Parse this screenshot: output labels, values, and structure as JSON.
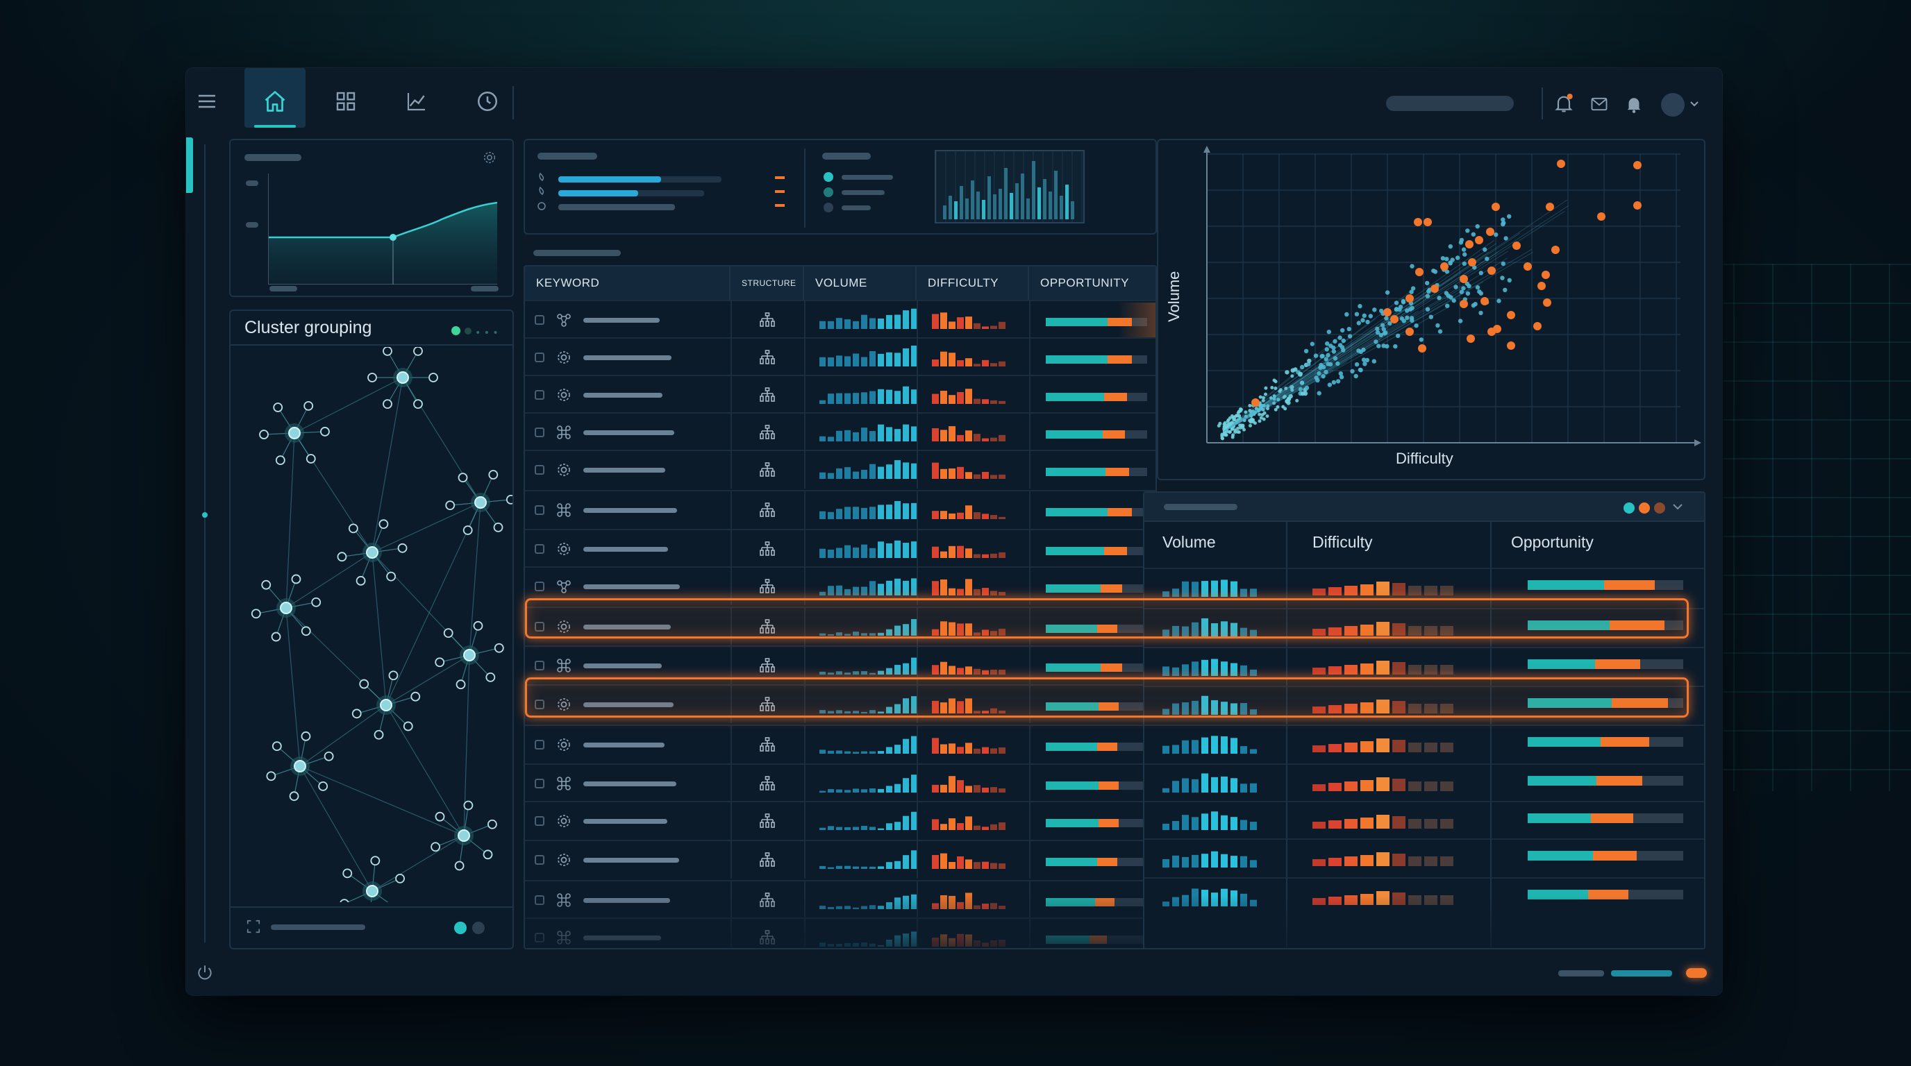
{
  "colors": {
    "accent": "#27c3c3",
    "teal": "#1aa3b8",
    "orange": "#f2772d",
    "red": "#d9432f",
    "panel": "#0c1b2a"
  },
  "toolbar": {
    "tabs": [
      {
        "icon": "home-icon",
        "selected": true
      },
      {
        "icon": "grid-icon"
      },
      {
        "icon": "chart-line-icon"
      },
      {
        "icon": "clock-icon"
      }
    ],
    "right_icons": [
      "notification-bell-icon",
      "mail-icon",
      "bell-icon",
      "user-avatar"
    ]
  },
  "cluster_panel": {
    "title": "Cluster grouping",
    "nodes": 9
  },
  "table": {
    "columns": [
      "KEYWORD",
      "STRUCTURE",
      "VOLUME",
      "DIFFICULTY",
      "OPPORTUNITY"
    ],
    "rows": [
      {
        "icon": "network-icon",
        "opp": 0.85,
        "hl": false
      },
      {
        "icon": "gear-icon",
        "opp": 0.85,
        "hl": false
      },
      {
        "icon": "gear-icon",
        "opp": 0.8,
        "hl": false
      },
      {
        "icon": "command-icon",
        "opp": 0.78,
        "hl": false
      },
      {
        "icon": "gear-icon",
        "opp": 0.82,
        "hl": false
      },
      {
        "icon": "command-icon",
        "opp": 0.85,
        "hl": false
      },
      {
        "icon": "gear-icon",
        "opp": 0.8,
        "hl": false
      },
      {
        "icon": "network-icon",
        "opp": 0.75,
        "hl": false
      },
      {
        "icon": "gear-icon",
        "opp": 0.7,
        "hl": true
      },
      {
        "icon": "command-icon",
        "opp": 0.75,
        "hl": false
      },
      {
        "icon": "gear-icon",
        "opp": 0.72,
        "hl": true
      },
      {
        "icon": "gear-icon",
        "opp": 0.7,
        "hl": false
      },
      {
        "icon": "command-icon",
        "opp": 0.72,
        "hl": false
      },
      {
        "icon": "gear-icon",
        "opp": 0.72,
        "hl": false
      },
      {
        "icon": "gear-icon",
        "opp": 0.7,
        "hl": false
      },
      {
        "icon": "command-icon",
        "opp": 0.68,
        "hl": false
      },
      {
        "icon": "command-icon",
        "opp": 0.6,
        "hl": false
      }
    ]
  },
  "scatter": {
    "xlabel": "Difficulty",
    "ylabel": "Volume"
  },
  "summary": {
    "columns": [
      "Volume",
      "Difficulty",
      "Opportunity"
    ]
  },
  "filter_card": {
    "bars": [
      0.62,
      0.48,
      0.7
    ]
  }
}
